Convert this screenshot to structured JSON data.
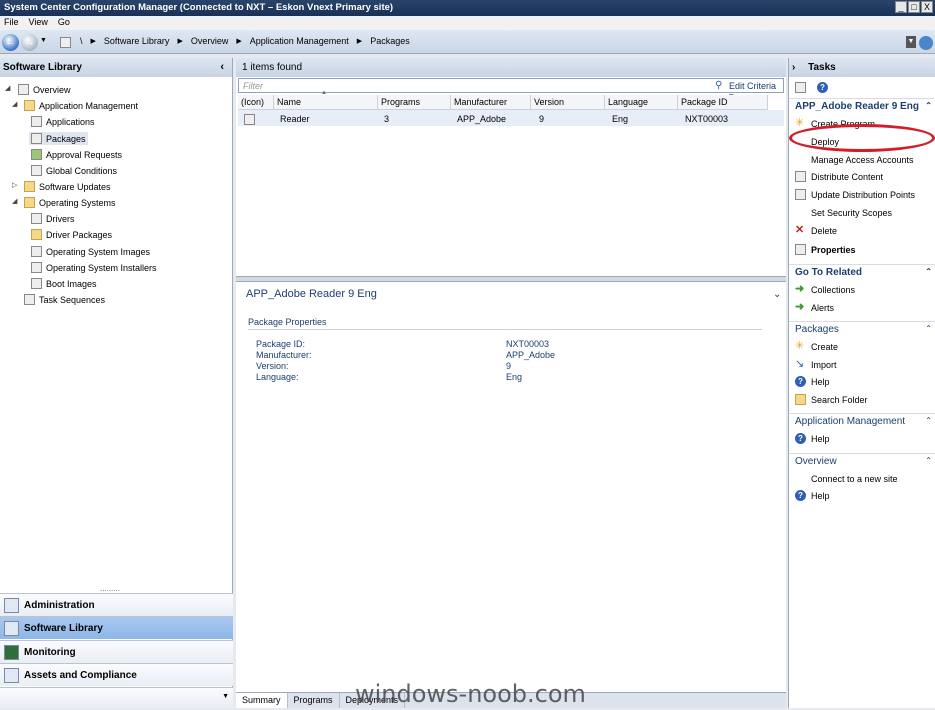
{
  "window": {
    "title": "System Center Configuration Manager (Connected to NXT – Eskon Vnext Primary site)",
    "buttons": [
      "_",
      "□",
      "X"
    ]
  },
  "menu": [
    "File",
    "View",
    "Go"
  ],
  "breadcrumbs": [
    "\\",
    "Software Library",
    "Overview",
    "Application Management",
    "Packages"
  ],
  "left": {
    "title": "Software Library",
    "tree": [
      {
        "label": "Overview"
      },
      {
        "label": "Application Management"
      },
      {
        "label": "Applications"
      },
      {
        "label": "Packages"
      },
      {
        "label": "Approval Requests"
      },
      {
        "label": "Global Conditions"
      },
      {
        "label": "Software Updates"
      },
      {
        "label": "Operating Systems"
      },
      {
        "label": "Drivers"
      },
      {
        "label": "Driver Packages"
      },
      {
        "label": "Operating System Images"
      },
      {
        "label": "Operating System Installers"
      },
      {
        "label": "Boot Images"
      },
      {
        "label": "Task Sequences"
      }
    ],
    "workspaces": [
      "Administration",
      "Software Library",
      "Monitoring",
      "Assets and Compliance"
    ],
    "grip": "........."
  },
  "list": {
    "count": "1 items found",
    "filter_placeholder": "Filter",
    "edit_criteria": "Edit Criteria",
    "columns": [
      "(Icon)",
      "Name",
      "Programs",
      "Manufacturer",
      "Version",
      "Language",
      "Package ID"
    ],
    "rows": [
      {
        "name": "Reader",
        "programs": "3",
        "manufacturer": "APP_Adobe",
        "version": "9",
        "language": "Eng",
        "package_id": "NXT00003"
      }
    ]
  },
  "detail": {
    "title": "APP_Adobe Reader 9 Eng",
    "section": "Package Properties",
    "labels": [
      "Package ID:",
      "Manufacturer:",
      "Version:",
      "Language:"
    ],
    "values": [
      "NXT00003",
      "APP_Adobe",
      "9",
      "Eng"
    ]
  },
  "tabs": [
    "Summary",
    "Programs",
    "Deployments"
  ],
  "tasks": {
    "title": "Tasks",
    "package_section": "APP_Adobe Reader 9 Eng",
    "package_items": [
      "Create Program",
      "Deploy",
      "Manage Access Accounts",
      "Distribute Content",
      "Update Distribution Points",
      "Set Security Scopes",
      "Delete",
      "Properties"
    ],
    "goto_section": "Go To Related",
    "goto_items": [
      "Collections",
      "Alerts"
    ],
    "packages_section": "Packages",
    "packages_items": [
      "Create",
      "Import",
      "Help",
      "Search Folder"
    ],
    "appmgmt_section": "Application Management",
    "appmgmt_items": [
      "Help"
    ],
    "overview_section": "Overview",
    "overview_items": [
      "Connect to a new site",
      "Help"
    ]
  },
  "watermark": "windows-noob.com",
  "colors": {
    "accent": "#1c3f6e",
    "selection": "#8db6e8",
    "highlight_circle": "#d01f2a"
  }
}
